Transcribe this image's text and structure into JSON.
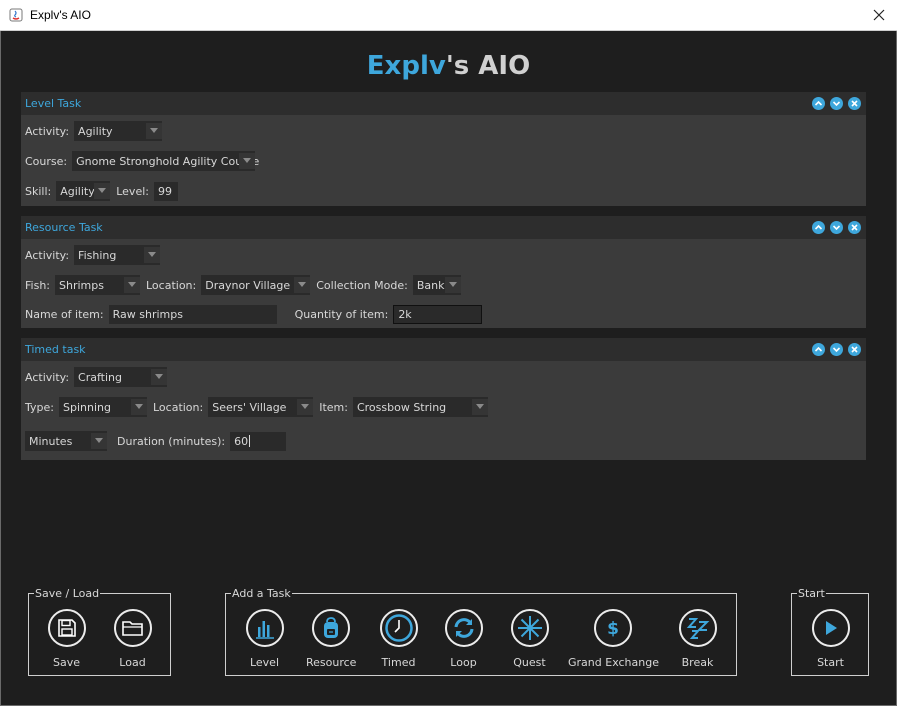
{
  "window": {
    "title": "Explv's AIO"
  },
  "app_title": {
    "accent": "Explv",
    "rest": "'s AIO"
  },
  "level_task": {
    "title": "Level Task",
    "activity_label": "Activity:",
    "activity_value": "Agility",
    "course_label": "Course:",
    "course_value": "Gnome Stronghold Agility Course",
    "skill_label": "Skill:",
    "skill_value": "Agility",
    "level_label": "Level:",
    "level_value": "99"
  },
  "resource_task": {
    "title": "Resource Task",
    "activity_label": "Activity:",
    "activity_value": "Fishing",
    "fish_label": "Fish:",
    "fish_value": "Shrimps",
    "location_label": "Location:",
    "location_value": "Draynor Village",
    "collection_label": "Collection Mode:",
    "collection_value": "Bank",
    "name_label": "Name of item:",
    "name_value": "Raw shrimps",
    "quantity_label": "Quantity of item:",
    "quantity_value": "2k"
  },
  "timed_task": {
    "title": "Timed task",
    "activity_label": "Activity:",
    "activity_value": "Crafting",
    "type_label": "Type:",
    "type_value": "Spinning",
    "location_label": "Location:",
    "location_value": "Seers' Village",
    "item_label": "Item:",
    "item_value": "Crossbow String",
    "unit_value": "Minutes",
    "duration_label": "Duration (minutes):",
    "duration_value": "60"
  },
  "save_load": {
    "title": "Save / Load",
    "save": "Save",
    "load": "Load"
  },
  "add_task": {
    "title": "Add a Task",
    "level": "Level",
    "resource": "Resource",
    "timed": "Timed",
    "loop": "Loop",
    "quest": "Quest",
    "grand_exchange": "Grand Exchange",
    "break": "Break"
  },
  "start_group": {
    "title": "Start",
    "start": "Start"
  },
  "colors": {
    "accent": "#3ea7dc",
    "background": "#1e1e1e",
    "panel": "#3b3b3b",
    "panel_header": "#2d2d2d"
  }
}
